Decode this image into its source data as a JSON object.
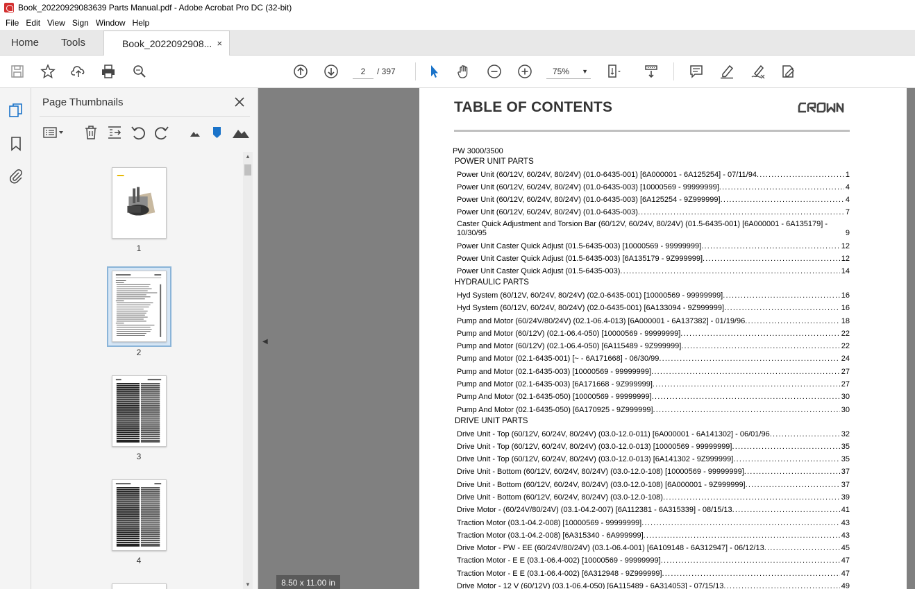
{
  "window": {
    "title": "Book_20220929083639 Parts Manual.pdf - Adobe Acrobat Pro DC (32-bit)"
  },
  "menu": [
    "File",
    "Edit",
    "View",
    "Sign",
    "Window",
    "Help"
  ],
  "tabs": {
    "home": "Home",
    "tools": "Tools",
    "document": "Book_2022092908...",
    "close": "×"
  },
  "toolbar": {
    "current_page": "2",
    "total_pages": "/ 397",
    "zoom": "75%",
    "icons": [
      "save-icon",
      "bookmark-star-icon",
      "share-upload-icon",
      "print-icon",
      "find-icon",
      "page-up-icon",
      "page-down-icon",
      "select-cursor-icon",
      "hand-icon",
      "zoom-out-icon",
      "zoom-in-icon",
      "page-fit-icon",
      "scroll-mode-icon",
      "comment-icon",
      "highlight-icon",
      "sign-icon",
      "fill-sign-icon"
    ]
  },
  "colors": {
    "selected_thumb_border": "#8ab4d8",
    "select_tool": "#1a73c9",
    "canvas_bg": "#808080"
  },
  "thumbpanel": {
    "title": "Page Thumbnails",
    "pages": [
      "1",
      "2",
      "3",
      "4"
    ]
  },
  "canvas": {
    "page_size": "8.50 x 11.00 in"
  },
  "doc": {
    "title": "TABLE OF CONTENTS",
    "brand": "CROWN",
    "model": "PW 3000/3500",
    "sections": [
      {
        "name": "POWER UNIT PARTS",
        "rows": [
          {
            "t": "Power Unit (60/12V, 60/24V, 80/24V) (01.0-6435-001)  [6A000001 - 6A125254] - 07/11/94",
            "p": "1"
          },
          {
            "t": "Power Unit (60/12V, 60/24V, 80/24V) (01.0-6435-003)  [10000569 - 99999999]",
            "p": "4"
          },
          {
            "t": "Power Unit (60/12V, 60/24V, 80/24V) (01.0-6435-003)  [6A125254 - 9Z999999]",
            "p": "4"
          },
          {
            "t": "Power Unit (60/12V, 60/24V, 80/24V) (01.0-6435-003)",
            "p": "7"
          },
          {
            "t": "Caster Quick Adjustment and Torsion Bar (60/12V, 60/24V, 80/24V) (01.5-6435-001)  [6A000001 - 6A135179] -",
            "t2": "10/30/95",
            "p": "9",
            "wrap": true
          },
          {
            "t": "Power Unit Caster Quick Adjust (01.5-6435-003)  [10000569 - 99999999]",
            "p": "12"
          },
          {
            "t": "Power Unit Caster Quick Adjust (01.5-6435-003)  [6A135179 - 9Z999999]",
            "p": "12"
          },
          {
            "t": "Power Unit Caster Quick Adjust (01.5-6435-003)",
            "p": "14"
          }
        ]
      },
      {
        "name": "HYDRAULIC PARTS",
        "rows": [
          {
            "t": "Hyd System (60/12V, 60/24V, 80/24V) (02.0-6435-001)  [10000569 - 99999999]",
            "p": "16"
          },
          {
            "t": "Hyd System (60/12V, 60/24V, 80/24V) (02.0-6435-001)  [6A133094 - 9Z999999]",
            "p": "16"
          },
          {
            "t": "Pump and Motor (60/24V/80/24V) (02.1-06.4-013)  [6A000001 - 6A137382] - 01/19/96",
            "p": "18"
          },
          {
            "t": "Pump and Motor (60/12V) (02.1-06.4-050)  [10000569 - 99999999]",
            "p": "22"
          },
          {
            "t": "Pump and Motor (60/12V) (02.1-06.4-050)  [6A115489 - 9Z999999]",
            "p": "22"
          },
          {
            "t": "Pump and Motor (02.1-6435-001)  [~ - 6A171668] - 06/30/99",
            "p": "24"
          },
          {
            "t": "Pump and Motor (02.1-6435-003)  [10000569 - 99999999]",
            "p": "27"
          },
          {
            "t": "Pump and Motor (02.1-6435-003)  [6A171668 - 9Z999999]",
            "p": "27"
          },
          {
            "t": "Pump And Motor (02.1-6435-050)  [10000569 - 99999999]",
            "p": "30"
          },
          {
            "t": "Pump And Motor (02.1-6435-050)  [6A170925 - 9Z999999]",
            "p": "30"
          }
        ]
      },
      {
        "name": "DRIVE UNIT PARTS",
        "rows": [
          {
            "t": "Drive Unit - Top (60/12V, 60/24V, 80/24V) (03.0-12.0-011)  [6A000001 - 6A141302] - 06/01/96",
            "p": "32"
          },
          {
            "t": "Drive Unit - Top (60/12V, 60/24V, 80/24V) (03.0-12.0-013)  [10000569 - 99999999]",
            "p": "35"
          },
          {
            "t": "Drive Unit - Top (60/12V, 60/24V, 80/24V) (03.0-12.0-013)  [6A141302 - 9Z999999]",
            "p": "35"
          },
          {
            "t": "Drive Unit - Bottom (60/12V, 60/24V, 80/24V) (03.0-12.0-108)  [10000569 - 99999999]",
            "p": "37"
          },
          {
            "t": "Drive Unit - Bottom (60/12V, 60/24V, 80/24V) (03.0-12.0-108)  [6A000001 - 9Z999999]",
            "p": "37"
          },
          {
            "t": "Drive Unit - Bottom (60/12V, 60/24V, 80/24V) (03.0-12.0-108)",
            "p": "39"
          },
          {
            "t": "Drive Motor - (60/24V/80/24V) (03.1-04.2-007)  [6A112381 - 6A315339] - 08/15/13",
            "p": "41"
          },
          {
            "t": "Traction Motor (03.1-04.2-008)  [10000569 - 99999999]",
            "p": "43"
          },
          {
            "t": "Traction Motor (03.1-04.2-008)  [6A315340 - 6A999999]",
            "p": "43"
          },
          {
            "t": "Drive Motor - PW - EE (60/24V/80/24V) (03.1-06.4-001)  [6A109148 - 6A312947] - 06/12/13",
            "p": "45"
          },
          {
            "t": "Traction Motor - E E (03.1-06.4-002)  [10000569 - 99999999]",
            "p": "47"
          },
          {
            "t": "Traction Motor - E E (03.1-06.4-002)  [6A312948 - 9Z999999]",
            "p": "47"
          },
          {
            "t": "Drive Motor - 12 V (60/12V) (03.1-06.4-050)  [6A115489 - 6A314053] - 07/15/13",
            "p": "49"
          }
        ]
      }
    ]
  }
}
